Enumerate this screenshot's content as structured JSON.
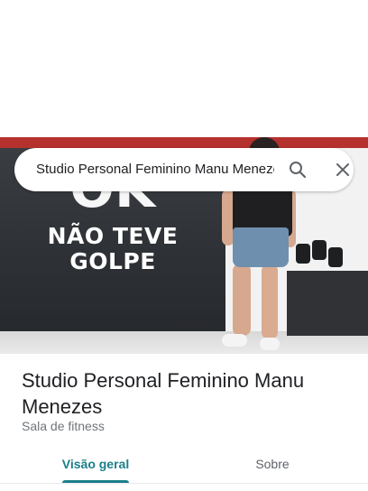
{
  "search": {
    "query": "Studio Personal Feminino Manu Menezes"
  },
  "hero_photo": {
    "wall_text_big": "OK",
    "wall_text_line1": "NÃO TEVE",
    "wall_text_line2": "GOLPE"
  },
  "place": {
    "name": "Studio Personal Feminino Manu Menezes",
    "category": "Sala de fitness"
  },
  "tabs": [
    {
      "label": "Visão geral",
      "selected": true
    },
    {
      "label": "Sobre",
      "selected": false
    }
  ],
  "colors": {
    "accent": "#1a7f89",
    "text_primary": "#202124",
    "text_secondary": "#70757a"
  }
}
